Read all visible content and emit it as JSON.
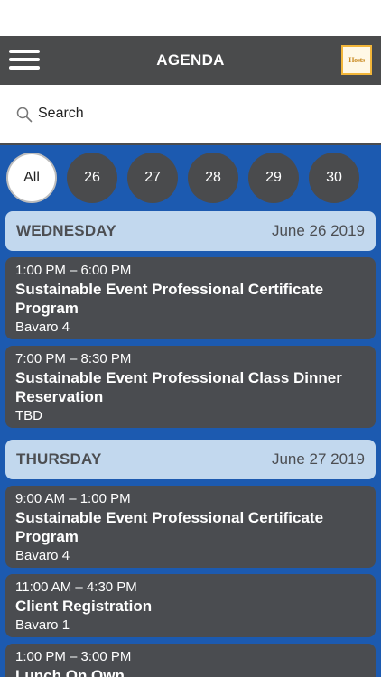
{
  "header": {
    "title": "AGENDA",
    "logo_text": "Hosts"
  },
  "search": {
    "placeholder": "Search"
  },
  "date_filter": [
    "All",
    "26",
    "27",
    "28",
    "29",
    "30"
  ],
  "colors": {
    "header": "#4a4b4c",
    "background": "#1c5ab0",
    "day_header": "#c2d8ee",
    "card": "#4a4c50"
  },
  "days": [
    {
      "name": "WEDNESDAY",
      "date": "June 26 2019",
      "sessions": [
        {
          "time": "1:00 PM – 6:00 PM",
          "title": "Sustainable Event Professional Certificate Program",
          "location": "Bavaro 4"
        },
        {
          "time": "7:00 PM – 8:30 PM",
          "title": "Sustainable Event Professional Class Dinner Reservation",
          "location": "TBD"
        }
      ]
    },
    {
      "name": "THURSDAY",
      "date": "June 27 2019",
      "sessions": [
        {
          "time": "9:00 AM – 1:00 PM",
          "title": "Sustainable Event Professional Certificate Program",
          "location": "Bavaro 4"
        },
        {
          "time": "11:00 AM – 4:30 PM",
          "title": "Client Registration",
          "location": "Bavaro 1"
        },
        {
          "time": "1:00 PM – 3:00 PM",
          "title": "Lunch On Own",
          "location": ""
        }
      ]
    }
  ]
}
